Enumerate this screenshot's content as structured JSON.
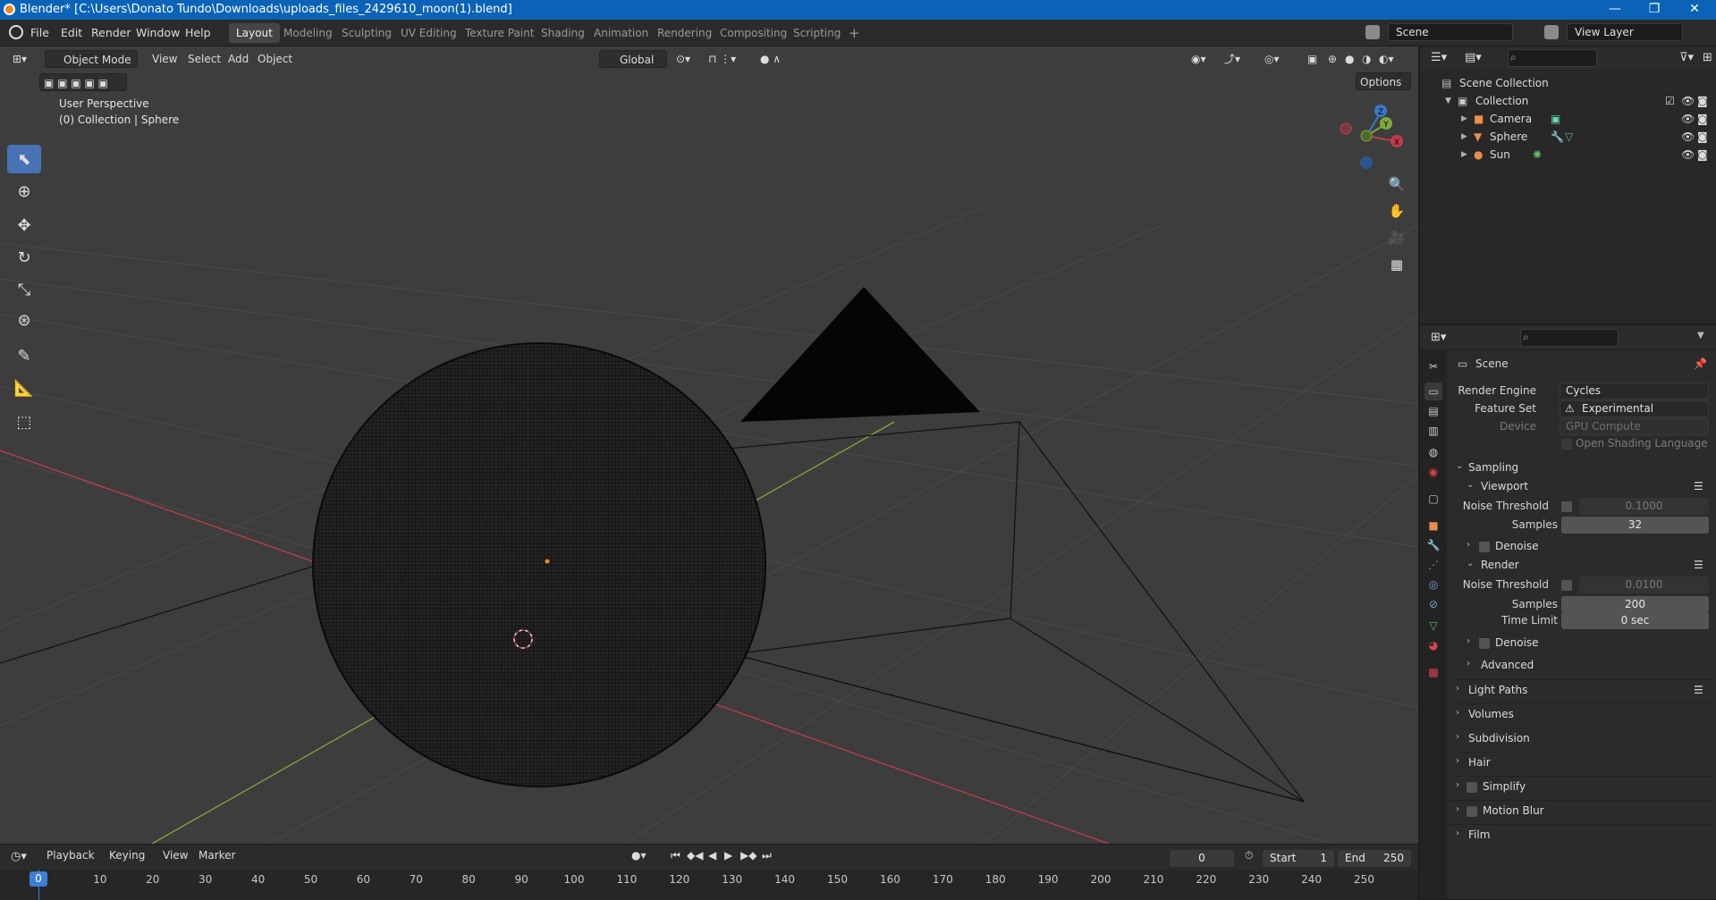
{
  "window": {
    "title": "Blender* [C:\\Users\\Donato Tundo\\Downloads\\uploads_files_2429610_moon(1).blend]",
    "min": "—",
    "max": "❐",
    "close": "✕"
  },
  "menu": [
    "File",
    "Edit",
    "Render",
    "Window",
    "Help"
  ],
  "workspaces": [
    "Layout",
    "Modeling",
    "Sculpting",
    "UV Editing",
    "Texture Paint",
    "Shading",
    "Animation",
    "Rendering",
    "Compositing",
    "Scripting",
    "+"
  ],
  "scene_field": "Scene",
  "view_layer_field": "View Layer",
  "viewport": {
    "mode": "Object Mode",
    "menus": [
      "View",
      "Select",
      "Add",
      "Object"
    ],
    "orientation": "Global",
    "options": "Options",
    "overlay_line1": "User Perspective",
    "overlay_line2": "(0) Collection | Sphere",
    "gizmo_labels": {
      "x": "X",
      "y": "Y",
      "z": "Z"
    }
  },
  "outliner": {
    "scene_collection": "Scene Collection",
    "collection": "Collection",
    "items": [
      "Camera",
      "Sphere",
      "Sun"
    ]
  },
  "properties": {
    "context": "Scene",
    "render_engine_label": "Render Engine",
    "render_engine": "Cycles",
    "feature_set_label": "Feature Set",
    "feature_set": "Experimental",
    "device_label": "Device",
    "device": "GPU Compute",
    "osl_label": "Open Shading Language",
    "sampling": "Sampling",
    "viewport": "Viewport",
    "noise_threshold_label": "Noise Threshold",
    "viewport_noise_threshold": "0.1000",
    "samples_label": "Samples",
    "viewport_samples": "32",
    "denoise": "Denoise",
    "render": "Render",
    "render_noise_threshold": "0.0100",
    "render_samples": "200",
    "time_limit_label": "Time Limit",
    "time_limit": "0 sec",
    "advanced": "Advanced",
    "light_paths": "Light Paths",
    "volumes": "Volumes",
    "subdivision": "Subdivision",
    "hair": "Hair",
    "simplify": "Simplify",
    "motion_blur": "Motion Blur",
    "film": "Film"
  },
  "timeline": {
    "menus": [
      "Playback",
      "Keying",
      "View",
      "Marker"
    ],
    "current_frame": "0",
    "start_label": "Start",
    "start": "1",
    "end_label": "End",
    "end": "250",
    "ticks": [
      "0",
      "10",
      "20",
      "30",
      "40",
      "50",
      "60",
      "70",
      "80",
      "90",
      "100",
      "110",
      "120",
      "130",
      "140",
      "150",
      "160",
      "170",
      "180",
      "190",
      "200",
      "210",
      "220",
      "230",
      "240",
      "250"
    ]
  },
  "colors": {
    "accent": "#4772b3",
    "titlebar": "#0a63b6",
    "x_axis": "#c03d4a",
    "y_axis": "#7fa83a",
    "z_axis": "#3b79c9",
    "current_frame": "#3d7fd6"
  }
}
